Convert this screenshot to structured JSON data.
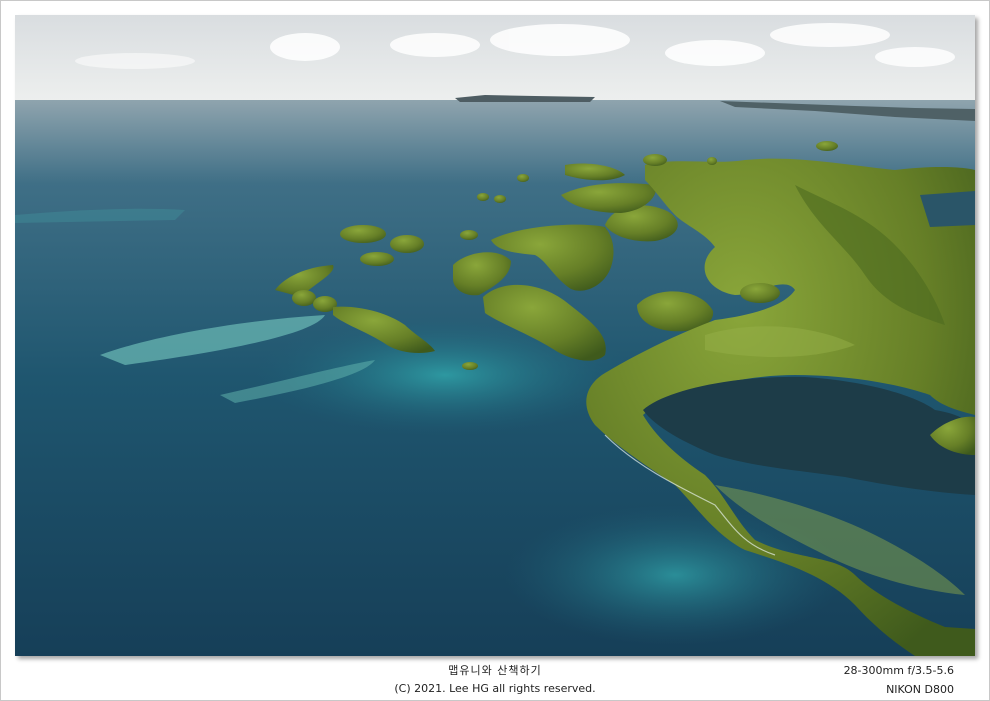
{
  "caption": {
    "title": "맵유니와 산책하기",
    "copyright": "(C) 2021. Lee HG all rights reserved.",
    "lens": "28-300mm f/3.5-5.6",
    "camera": "NIKON D800"
  },
  "photo": {
    "subject": "aerial-islands",
    "colors": {
      "sky": "#e9ebec",
      "ocean_deep": "#1c4c66",
      "ocean_mid": "#21637a",
      "lagoon": "#2a8c98",
      "reef": "#5fb7b2",
      "forest_dark": "#3f5a1c",
      "forest": "#6c8a2a",
      "forest_light": "#8aa63a"
    }
  }
}
